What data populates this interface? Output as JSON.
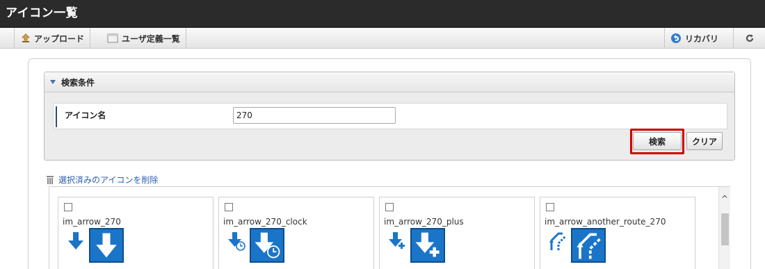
{
  "window": {
    "title": "アイコン一覧"
  },
  "toolbar": {
    "upload_label": "アップロード",
    "user_def_label": "ユーザ定義一覧",
    "recover_label": "リカバリ",
    "upload_icon": "upload-icon",
    "user_def_icon": "list-icon",
    "recover_icon": "undo-icon",
    "reload_icon": "reload-icon"
  },
  "search": {
    "header": "検索条件",
    "field_label": "アイコン名",
    "field_value": "270",
    "search_button": "検索",
    "clear_button": "クリア"
  },
  "actions": {
    "delete_selected": "選択済みのアイコンを削除"
  },
  "icons": [
    {
      "name": "im_arrow_270",
      "checked": false
    },
    {
      "name": "im_arrow_270_clock",
      "checked": false
    },
    {
      "name": "im_arrow_270_plus",
      "checked": false
    },
    {
      "name": "im_arrow_another_route_270",
      "checked": false
    }
  ],
  "colors": {
    "highlight": "#d00000",
    "icon_blue": "#1a75c8",
    "link": "#2a5db0"
  }
}
